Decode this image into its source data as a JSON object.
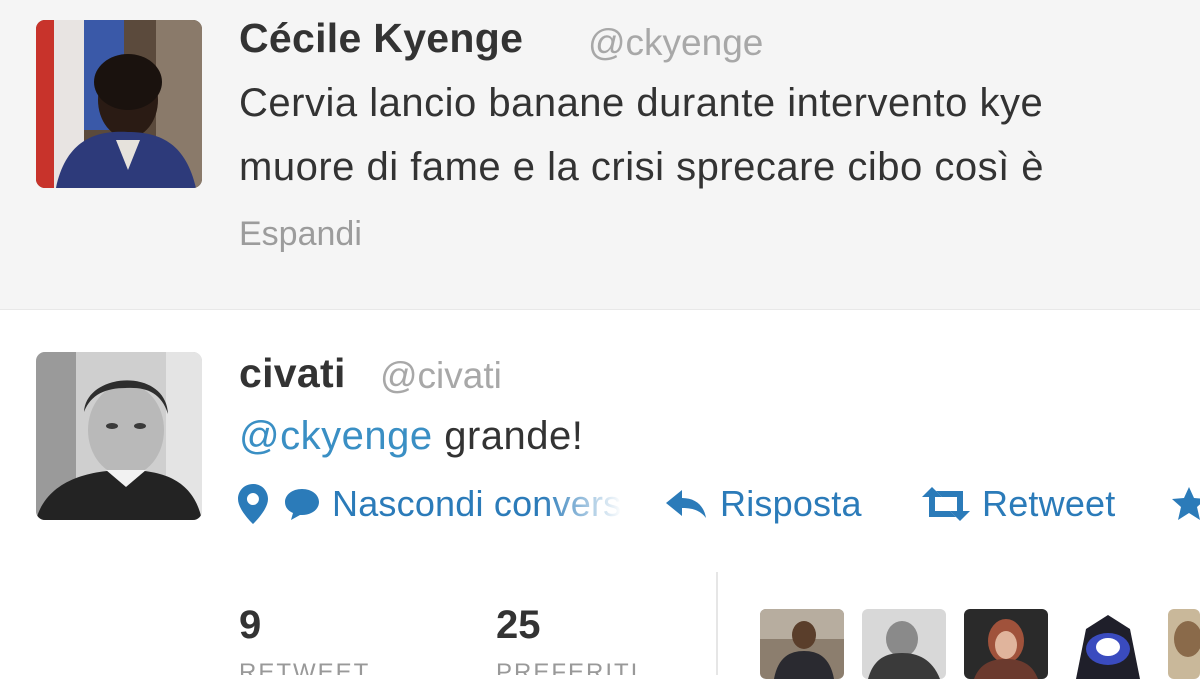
{
  "tweet_1": {
    "display_name": "Cécile Kyenge",
    "handle": "@ckyenge",
    "text_line_1": "Cervia lancio banane durante intervento kye",
    "text_line_2": "muore di fame e la crisi sprecare cibo così è",
    "expand_label": "Espandi"
  },
  "tweet_2": {
    "display_name": "civati",
    "handle": "@civati",
    "mention": "@ckyenge",
    "text": " grande!",
    "actions": {
      "hide_conversation": "Nascondi conversazione",
      "reply": "Risposta",
      "retweet": "Retweet"
    },
    "stats": [
      {
        "value": "9",
        "label": "RETWEET"
      },
      {
        "value": "25",
        "label": "PREFERITI"
      }
    ]
  },
  "colors": {
    "link": "#2b7bb9",
    "top_background": "#f5f5f5",
    "handle_gray": "#a8a8a8"
  },
  "icons": [
    "map-pin-icon",
    "speech-bubble-icon",
    "reply-arrow-icon",
    "retweet-icon",
    "star-icon"
  ]
}
